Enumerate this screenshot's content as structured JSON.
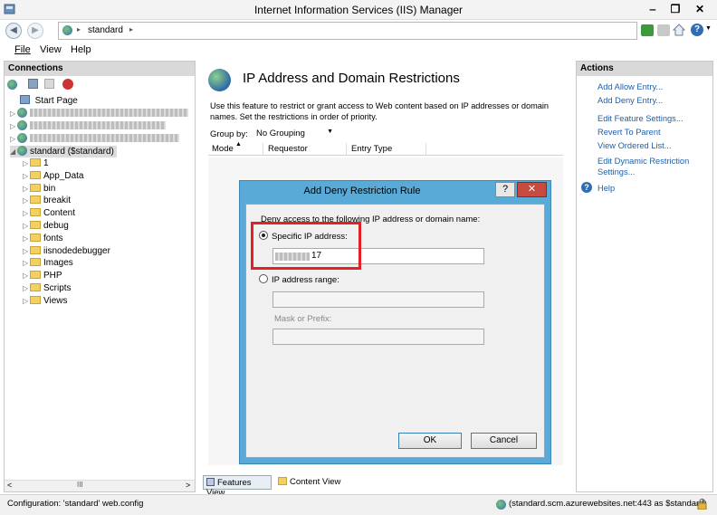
{
  "window": {
    "title": "Internet Information Services (IIS) Manager",
    "min": "‒",
    "max": "❐",
    "close": "✕"
  },
  "address": {
    "path": "standard",
    "sep1": "▸",
    "sep2": "▸"
  },
  "menu": {
    "file": "File",
    "view": "View",
    "help": "Help"
  },
  "connections": {
    "header": "Connections",
    "start_page": "Start Page",
    "site": "standard ($standard)",
    "folders": [
      "1",
      "App_Data",
      "bin",
      "breakit",
      "Content",
      "debug",
      "fonts",
      "iisnodedebugger",
      "Images",
      "PHP",
      "Scripts",
      "Views"
    ]
  },
  "feature": {
    "title": "IP Address and Domain Restrictions",
    "description": "Use this feature to restrict or grant access to Web content based on IP addresses or domain names. Set the restrictions in order of priority.",
    "group_by_label": "Group by:",
    "group_by_value": "No Grouping",
    "columns": [
      "Mode",
      "Requestor",
      "Entry Type"
    ]
  },
  "dialog": {
    "title": "Add Deny Restriction Rule",
    "help": "?",
    "close": "✕",
    "prompt": "Deny access to the following IP address or domain name:",
    "specific_label": "Specific IP address:",
    "specific_value_suffix": "17",
    "range_label": "IP address range:",
    "mask_label": "Mask or Prefix:",
    "ok": "OK",
    "cancel": "Cancel"
  },
  "actions": {
    "header": "Actions",
    "items": [
      "Add Allow Entry...",
      "Add Deny Entry...",
      "Edit Feature Settings...",
      "Revert To Parent",
      "View Ordered List...",
      "Edit Dynamic Restriction Settings...",
      "Help"
    ]
  },
  "bottom_tabs": {
    "features_view": "Features View",
    "content_view": "Content View"
  },
  "status": {
    "left": "Configuration: 'standard' web.config",
    "right": "(standard.scm.azurewebsites.net:443 as $standard)"
  },
  "scrollbar": {
    "left_arrow": "<",
    "thumb": "III",
    "right_arrow": ">"
  },
  "colors": {
    "highlight_box": "#e3202a",
    "dialog_frame": "#5aaad8",
    "link": "#1f5fa8"
  }
}
